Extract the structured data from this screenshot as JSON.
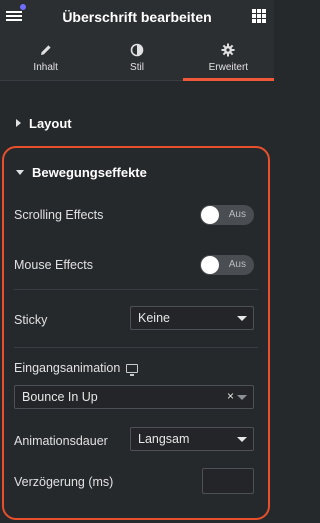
{
  "header": {
    "title": "Überschrift bearbeiten"
  },
  "tabs": [
    {
      "label": "Inhalt",
      "icon": "pencil-icon"
    },
    {
      "label": "Stil",
      "icon": "contrast-icon"
    },
    {
      "label": "Erweitert",
      "icon": "gear-icon",
      "active": true
    }
  ],
  "sections": {
    "layout": "Layout",
    "motion": "Bewegungseffekte"
  },
  "motion": {
    "scrolling_label": "Scrolling Effects",
    "scrolling_state": "Aus",
    "mouse_label": "Mouse Effects",
    "mouse_state": "Aus",
    "sticky_label": "Sticky",
    "sticky_value": "Keine",
    "entrance_label": "Eingangsanimation",
    "entrance_value": "Bounce In Up",
    "clear_symbol": "×",
    "duration_label": "Animationsdauer",
    "duration_value": "Langsam",
    "delay_label": "Verzögerung (ms)",
    "delay_value": ""
  },
  "colors": {
    "accent": "#f05a3a",
    "highlight": "#e8502d",
    "notification": "#6d6dff"
  }
}
